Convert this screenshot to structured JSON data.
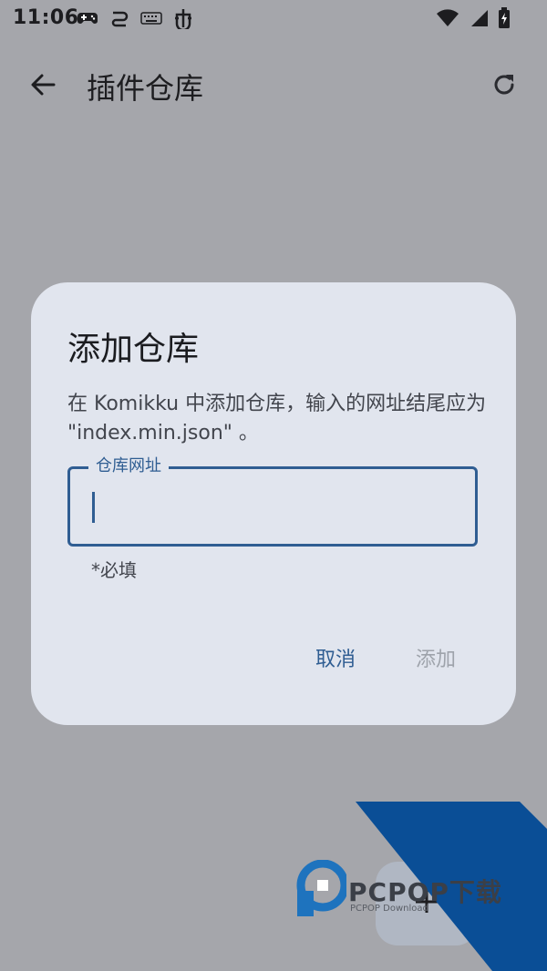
{
  "status_bar": {
    "time": "11:06",
    "left_icons": [
      "gamepad-icon",
      "sync-icon",
      "keyboard-icon",
      "bug-icon"
    ],
    "right_icons": [
      "wifi-icon",
      "signal-icon",
      "battery-charging-icon"
    ]
  },
  "app_bar": {
    "title": "插件仓库",
    "back_icon": "arrow-left-icon",
    "refresh_icon": "refresh-icon"
  },
  "dialog": {
    "title": "添加仓库",
    "message": "在 Komikku 中添加仓库，输入的网址结尾应为 \"index.min.json\" 。",
    "field_label": "仓库网址",
    "field_value": "",
    "helper_text": "*必填",
    "cancel_label": "取消",
    "add_label": "添加"
  },
  "fab": {
    "icon": "plus-icon"
  },
  "watermark": {
    "brand": "PCPOP下载",
    "sub": "PCPOP Download"
  },
  "colors": {
    "scrim": "#a5a6ab",
    "dialog_bg": "#e1e5ee",
    "primary": "#2f5d92",
    "disabled_text": "#9ea3ab",
    "watermark_blue": "#0a4e96"
  }
}
